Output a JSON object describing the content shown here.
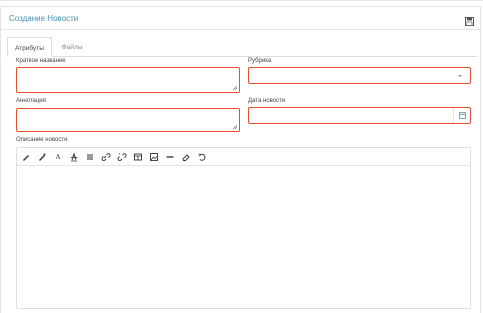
{
  "header": {
    "title": "Создание Новости",
    "save_icon": "save-icon"
  },
  "tabs": [
    {
      "label": "Атрибуты",
      "active": true
    },
    {
      "label": "Файлы",
      "active": false
    }
  ],
  "form": {
    "short_name_label": "Краткое название",
    "short_name_value": "",
    "rubric_label": "Рубрика",
    "rubric_value": "",
    "annotation_label": "Аннотация",
    "annotation_value": "",
    "date_label": "Дата новости",
    "date_value": "",
    "description_label": "Описание новости"
  },
  "toolbar_icons": [
    "bold-icon",
    "italic-icon",
    "font-icon",
    "strikethrough-icon",
    "list-icon",
    "link-icon",
    "unlink-icon",
    "table-icon",
    "image-icon",
    "horizontal-rule-icon",
    "eraser-icon",
    "undo-icon"
  ],
  "colors": {
    "accent": "#4a8fb5",
    "error_border": "#e2502f",
    "border": "#dddddd"
  }
}
